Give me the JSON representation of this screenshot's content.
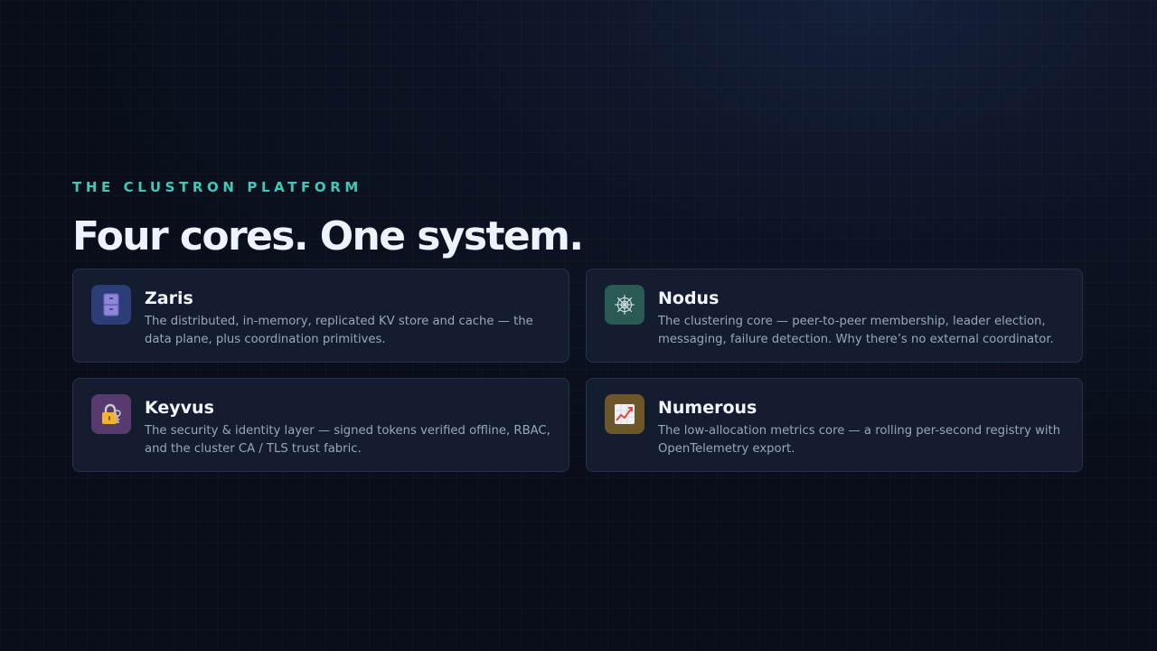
{
  "eyebrow": "THE CLUSTRON PLATFORM",
  "headline": "Four cores. One system.",
  "colors": {
    "accent": "#3ec9b7",
    "card_background": "#141d30",
    "card_border": "#26324a"
  },
  "cards": [
    {
      "title": "Zaris",
      "description": "The distributed, in-memory, replicated KV store and cache — the data plane, plus coordination primitives.",
      "icon": "file-cabinet-icon",
      "icon_bg": "#2b3e78"
    },
    {
      "title": "Nodus",
      "description": "The clustering core — peer-to-peer membership, leader election, messaging, failure detection. Why there’s no external coordinator.",
      "icon": "network-web-icon",
      "icon_bg": "#2a5a52"
    },
    {
      "title": "Keyvus",
      "description": "The security & identity layer — signed tokens verified offline, RBAC, and the cluster CA / TLS trust fabric.",
      "icon": "lock-with-key-icon",
      "icon_bg": "#573a6e"
    },
    {
      "title": "Numerous",
      "description": "The low-allocation metrics core — a rolling per-second registry with OpenTelemetry export.",
      "icon": "chart-increasing-icon",
      "icon_bg": "#6b5728"
    }
  ]
}
